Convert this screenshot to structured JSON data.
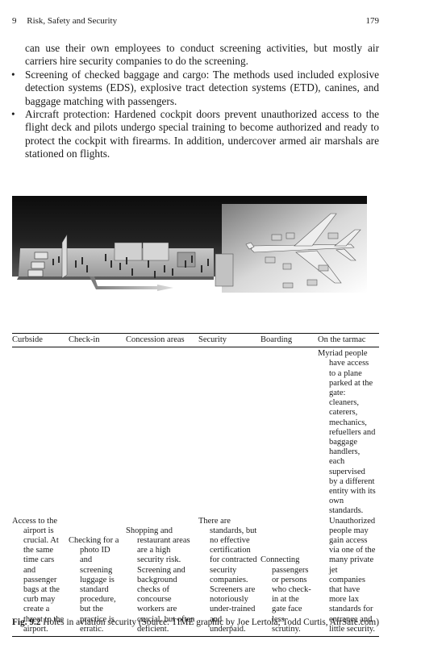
{
  "running_head": {
    "chapter_number": "9",
    "chapter_title": "Risk, Safety and Security",
    "page_number": "179"
  },
  "body": {
    "continuation": "can use their own employees to conduct screening activities, but mostly air carriers hire security companies to do the screening.",
    "bullets": [
      "Screening of checked baggage and cargo: The methods used included explosive detection systems (EDS), explosive tract detection systems (ETD), canines, and baggage matching with passengers.",
      "Aircraft protection: Hardened cockpit doors prevent unauthorized access to the flight deck and pilots undergo special training to become authorized and ready to protect the cockpit with firearms. In addition, undercover armed air marshals are stationed on flights."
    ]
  },
  "figure": {
    "image_description": "Grayscale illustration of an airport: curbside with cars, check-in hall, concession areas, security checkpoint, boarding gate and a jet airliner on the tarmac surrounded by service vehicles; an arrow shows the passenger path."
  },
  "table": {
    "headers": [
      "Curbside",
      "Check-in",
      "Concession areas",
      "Security",
      "Boarding",
      "On the tarmac"
    ],
    "cells": [
      "Access to the airport is crucial. At the same time cars and passenger bags at the curb may create a threat to the airport.",
      "Checking for a photo ID and screening luggage is standard procedure, but the practice is erratic.",
      "Shopping and restaurant areas are a high security risk. Screening and background checks of concourse workers are crucial, but often deficient.",
      "There are standards, but no effective certification for contracted security companies. Screeners are notoriously under-trained and underpaid.",
      "Connecting passengers or persons who check-in at the gate face less scrutiny.",
      "Myriad people have access to a plane parked at the gate: cleaners, caterers, mechanics, refuellers and baggage handlers, each supervised by a different entity with its own standards. Unauthorized people may gain access via one of the many private jet companies that have more lax standards for entrance and little security."
    ]
  },
  "caption": {
    "label": "Fig. 9.2",
    "text": " Holes in aviation security (Source: TIME graphic by Joe Lertola; Todd Curtis, AirSafe.com)"
  },
  "bullet_glyph": "•"
}
